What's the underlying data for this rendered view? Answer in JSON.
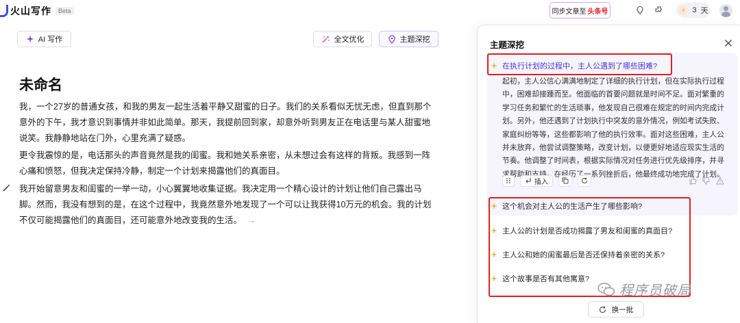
{
  "app": {
    "name": "火山写作",
    "badge": "Beta"
  },
  "topbar": {
    "sync_label": "同步文章至",
    "sync_brand": "头条号",
    "days_count": "3",
    "days_unit": "天",
    "icons": [
      "bulb-icon",
      "plugin-icon",
      "bolt-icon",
      "avatar"
    ]
  },
  "toolbar": {
    "ai_write": "AI 写作",
    "polish": "全文优化",
    "explore": "主题深挖"
  },
  "document": {
    "title": "未命名",
    "paragraphs": [
      "我，一个27岁的普通女孩，和我的男友一起生活着平静又甜蜜的日子。我们的关系看似无忧无虑，但直到那个意外的下午，我才意识到事情并非如此简单。那天，我提前回到家，却意外听到男友正在电话里与某人甜蜜地说笑。我静静地站在门外，心里充满了疑惑。",
      "更令我震惊的是，电话那头的声音竟然是我的闺蜜。我和她关系亲密，从未想过会有这样的背叛。我感到一阵心痛和愤怒，但我决定保持冷静，制定一个计划来揭露他们的真面目。",
      "我开始留意男友和闺蜜的一举一动，小心翼翼地收集证据。我决定用一个精心设计的计划让他们自己露出马脚。然而，我没有想到的是，在这个过程中，我竟然意外地发现了一个可以让我获得10万元的机会。我的计划不仅可能揭露他们的真面目，还可能意外地改变我的生活。"
    ],
    "next_arrow": "→"
  },
  "panel": {
    "title": "主题深挖",
    "active_question": "在执行计划的过程中，主人公遇到了哪些困难?",
    "answer": "起初，主人公信心满满地制定了详细的执行计划，但在实际执行过程中，困难却接踵而至。他面临的首要问题就是时间不足。面对繁重的学习任务和繁忙的生活琐事，他发现自己很难在规定的时间内完成计划。另外，他还遇到了计划执行中突发的意外情况，例如考试失败、家庭纠纷等等，这些都影响了他的执行效率。面对这些困难，主人公并未放弃，他尝试调整策略，改变计划，以便更好地适应现实生活的节奏。他调整了时间表，根据实际情况对任务进行优先级排序，并寻求帮助和支持。在经历了一系列挫折后，他最终成功地完成了计划。",
    "insert_label": "插入",
    "questions": [
      "这个机会对主人公的生活产生了哪些影响?",
      "主人公的计划是否成功揭露了男友和闺蜜的真面目?",
      "主人公和她的闺蜜最后是否还保持着亲密的关系?",
      "这个故事是否有其他寓意?"
    ],
    "refresh_label": "换一批"
  },
  "watermark": {
    "text": "程序员破局"
  },
  "colors": {
    "accent": "#4c35d6",
    "highlight_border": "#e02020",
    "card_bg": "#f6f4fd",
    "brand_red": "#e5282f"
  }
}
